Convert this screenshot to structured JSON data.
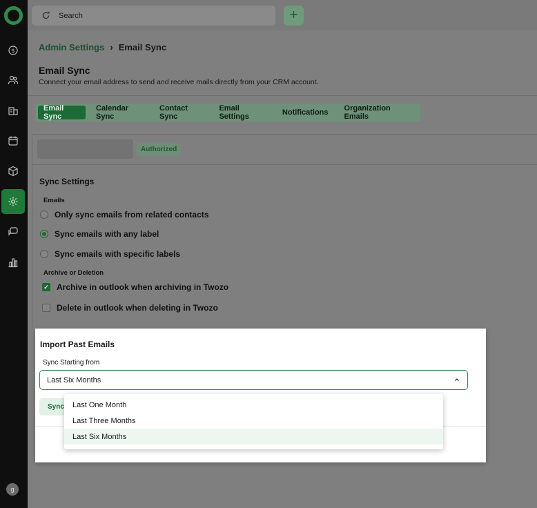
{
  "search": {
    "placeholder": "Search"
  },
  "breadcrumb": {
    "parent": "Admin Settings",
    "separator": "›",
    "current": "Email Sync"
  },
  "page": {
    "title": "Email Sync",
    "subtitle": "Connect your email address to send and receive mails directly from your CRM account."
  },
  "tabs": [
    "Email Sync",
    "Calendar Sync",
    "Contact Sync",
    "Email Settings",
    "Notifications",
    "Organization Emails"
  ],
  "account": {
    "status": "Authorized"
  },
  "sync_settings": {
    "title": "Sync Settings",
    "emails_label": "Emails",
    "options": [
      "Only sync emails from related contacts",
      "Sync emails with any label",
      "Sync emails with specific labels"
    ],
    "selected_option": "Sync emails with any label",
    "archive_label": "Archive or Deletion",
    "archive_checkbox": "Archive in outlook when archiving in Twozo",
    "archive_checked": true,
    "delete_checkbox": "Delete in outlook when deleting in Twozo",
    "delete_checked": false
  },
  "import_modal": {
    "title": "Import Past Emails",
    "field_label": "Sync Starting from",
    "selected_value": "Last Six Months",
    "button_label": "Sync",
    "options": [
      "Last One Month",
      "Last Three Months",
      "Last Six Months"
    ]
  },
  "user": {
    "avatar_initial": "g"
  },
  "colors": {
    "accent": "#1c6a35",
    "accent_border": "#2c8a4a"
  }
}
